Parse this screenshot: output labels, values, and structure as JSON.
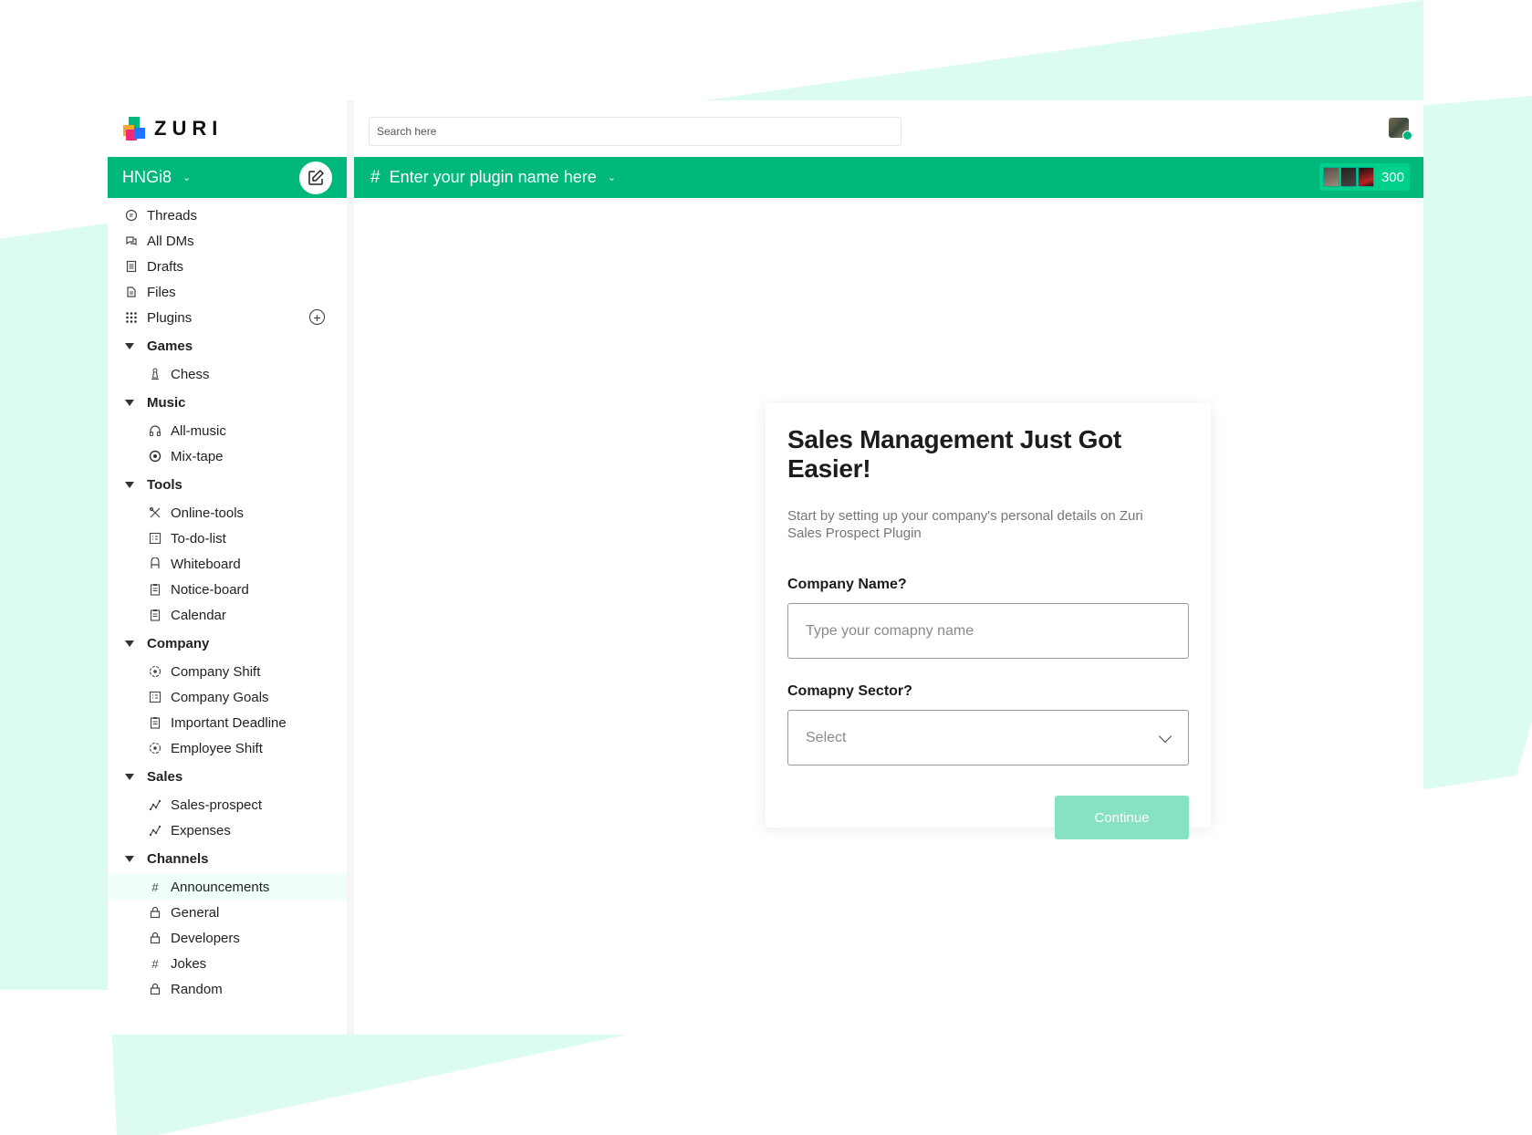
{
  "brand": {
    "name": "ZURI"
  },
  "workspace": {
    "name": "HNGi8"
  },
  "search": {
    "placeholder": "Search here"
  },
  "plugin": {
    "title": "Enter your plugin name here",
    "member_count": "300"
  },
  "sidebar": {
    "top": [
      {
        "label": "Threads",
        "icon": "threads-icon"
      },
      {
        "label": "All DMs",
        "icon": "dms-icon"
      },
      {
        "label": "Drafts",
        "icon": "drafts-icon"
      },
      {
        "label": "Files",
        "icon": "files-icon"
      },
      {
        "label": "Plugins",
        "icon": "grid-icon"
      }
    ],
    "sections": [
      {
        "title": "Games",
        "items": [
          {
            "label": "Chess",
            "icon": "chess-icon"
          }
        ]
      },
      {
        "title": "Music",
        "items": [
          {
            "label": "All-music",
            "icon": "headphones-icon"
          },
          {
            "label": "Mix-tape",
            "icon": "disc-icon"
          }
        ]
      },
      {
        "title": "Tools",
        "items": [
          {
            "label": "Online-tools",
            "icon": "tools-icon"
          },
          {
            "label": "To-do-list",
            "icon": "list-icon"
          },
          {
            "label": "Whiteboard",
            "icon": "board-icon"
          },
          {
            "label": "Notice-board",
            "icon": "clipboard-icon"
          },
          {
            "label": "Calendar",
            "icon": "calendar-icon"
          }
        ]
      },
      {
        "title": "Company",
        "items": [
          {
            "label": "Company Shift",
            "icon": "shift-icon"
          },
          {
            "label": "Company Goals",
            "icon": "goals-icon"
          },
          {
            "label": "Important Deadline",
            "icon": "deadline-icon"
          },
          {
            "label": "Employee Shift",
            "icon": "shift-icon"
          }
        ]
      },
      {
        "title": "Sales",
        "items": [
          {
            "label": "Sales-prospect",
            "icon": "chart-icon"
          },
          {
            "label": "Expenses",
            "icon": "chart-icon"
          }
        ]
      },
      {
        "title": "Channels",
        "items": [
          {
            "label": "Announcements",
            "icon": "hash-icon"
          },
          {
            "label": "General",
            "icon": "lock-icon"
          },
          {
            "label": "Developers",
            "icon": "lock-icon"
          },
          {
            "label": "Jokes",
            "icon": "hash-icon"
          },
          {
            "label": "Random",
            "icon": "lock-icon"
          }
        ]
      }
    ]
  },
  "form": {
    "title": "Sales Management Just Got Easier!",
    "subtitle": "Start by setting up your company's personal details on Zuri Sales Prospect Plugin",
    "company_name_label": "Company Name?",
    "company_name_placeholder": "Type your comapny name",
    "sector_label": "Comapny Sector?",
    "sector_value": "Select",
    "continue_label": "Continue"
  },
  "colors": {
    "brand_green": "#00b87c",
    "button_disabled": "#86e2c0",
    "background_accent": "#dcfcef"
  }
}
